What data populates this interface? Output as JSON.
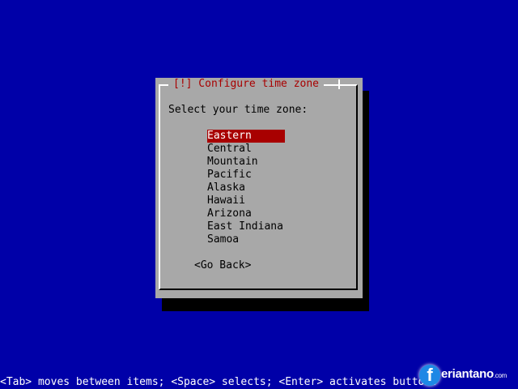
{
  "dialog": {
    "title": "[!] Configure time zone",
    "prompt": "Select your time zone:",
    "selected": "Eastern",
    "time_zones": [
      "Eastern",
      "Central",
      "Mountain",
      "Pacific",
      "Alaska",
      "Hawaii",
      "Arizona",
      "East Indiana",
      "Samoa"
    ],
    "go_back": "<Go Back>"
  },
  "help_bar": "<Tab> moves between items; <Space> selects; <Enter> activates buttons",
  "watermark": {
    "logo_letter": "f",
    "name": "eriantano",
    "suffix": ".com"
  },
  "colors": {
    "background": "#0000a8",
    "dialog": "#a8a8a8",
    "title": "#a80000",
    "highlight": "#a80000",
    "help_text": "#ffffff"
  }
}
